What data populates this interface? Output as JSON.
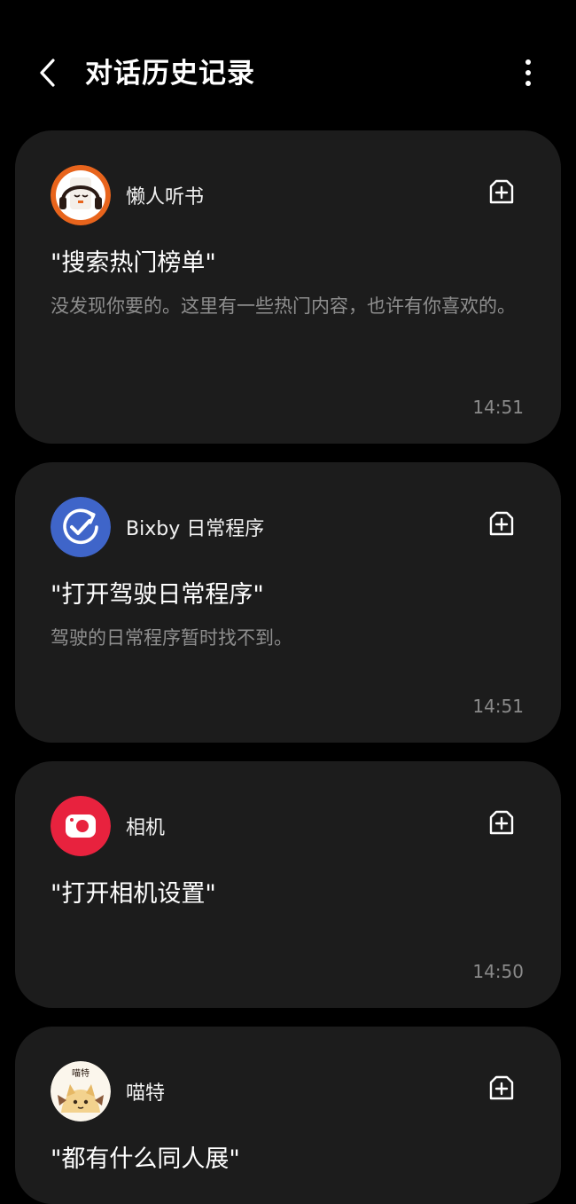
{
  "header": {
    "title": "对话历史记录"
  },
  "conversations": [
    {
      "app_name": "懒人听书",
      "app_icon": "lazy-audiobook-icon",
      "query": "\"搜索热门榜单\"",
      "reply": "没发现你要的。这里有一些热门内容，也许有你喜欢的。",
      "time": "14:51"
    },
    {
      "app_name": "Bixby 日常程序",
      "app_icon": "bixby-routines-icon",
      "query": "\"打开驾驶日常程序\"",
      "reply": "驾驶的日常程序暂时找不到。",
      "time": "14:51"
    },
    {
      "app_name": "相机",
      "app_icon": "camera-icon",
      "query": "\"打开相机设置\"",
      "reply": "",
      "time": "14:50"
    },
    {
      "app_name": "喵特",
      "app_icon": "miaote-icon",
      "icon_text": "喵特",
      "query": "\"都有什么同人展\"",
      "reply": "",
      "time": ""
    }
  ],
  "colors": {
    "background": "#000000",
    "card": "#1c1c1c",
    "secondary_text": "#8e8e8e",
    "bixby_blue": "#3f65c9",
    "camera_red": "#e8223e",
    "audiobook_orange": "#e8641c"
  }
}
